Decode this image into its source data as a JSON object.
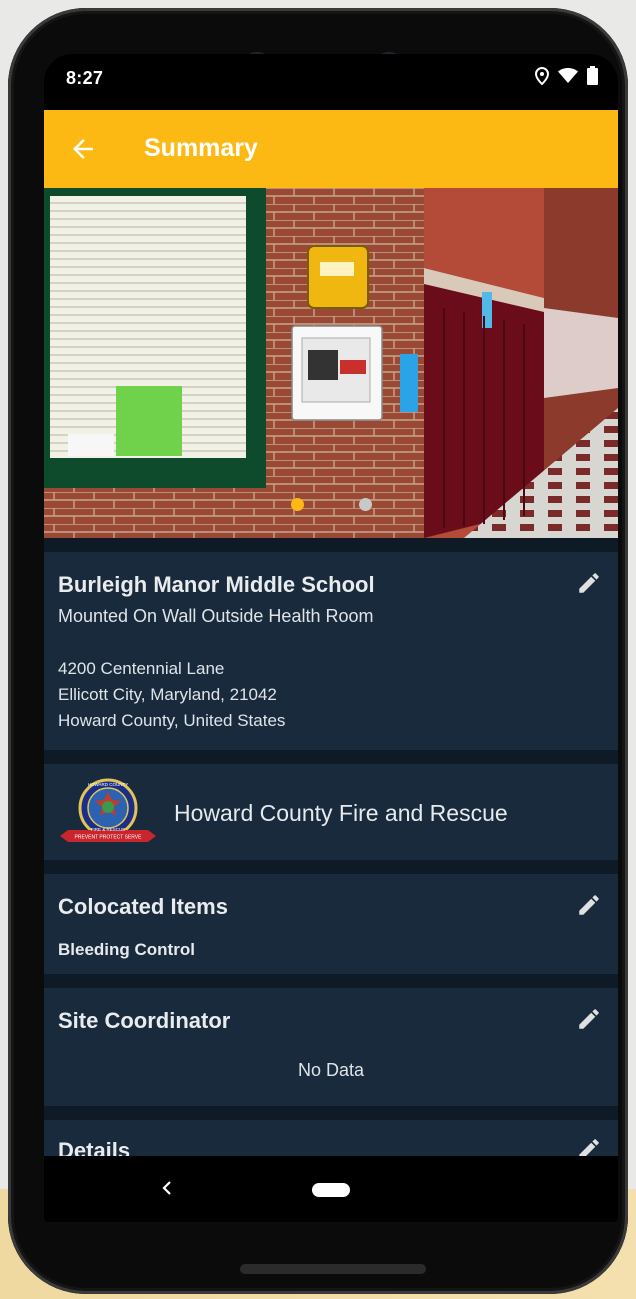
{
  "status_bar": {
    "time": "8:27"
  },
  "app_bar": {
    "title": "Summary"
  },
  "carousel": {
    "page_count": 2,
    "active_index": 0
  },
  "location": {
    "name": "Burleigh Manor Middle School",
    "placement": "Mounted On Wall Outside Health Room",
    "address_line1": "4200 Centennial Lane",
    "address_line2": "Ellicott City, Maryland, 21042",
    "address_line3": "Howard County, United States"
  },
  "organization": {
    "name": "Howard County Fire and Rescue",
    "logo_top": "HOWARD COUNTY",
    "logo_bottom": "FIRE & RESCUE",
    "logo_banner": "PREVENT PROTECT SERVE"
  },
  "colocated": {
    "title": "Colocated Items",
    "item": "Bleeding Control"
  },
  "coordinator": {
    "title": "Site Coordinator",
    "empty": "No Data"
  },
  "details": {
    "title": "Details"
  },
  "colors": {
    "accent": "#fdb913",
    "card": "#182a3b",
    "background": "#0e1a25",
    "active_dot": "#fdb913",
    "inactive_dot": "#c8c8c8"
  }
}
